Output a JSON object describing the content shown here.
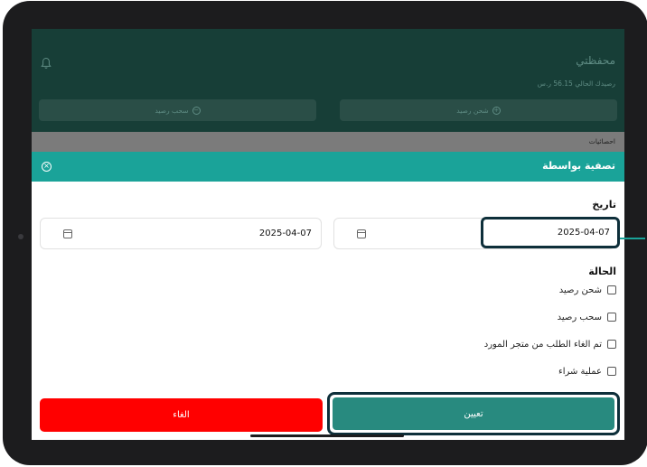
{
  "wallet": {
    "title": "محفظتي",
    "balance": "رصيدك الحالي 56.15 ر.س",
    "charge_label": "شحن رصيد",
    "withdraw_label": "سحب رصيد"
  },
  "stats_label": "احصائيات",
  "filter": {
    "title": "تصفية بواسطة",
    "date_label": "تاريخ",
    "date_from": "2025-04-07",
    "date_to": "2025-04-07",
    "status_label": "الحالة",
    "options": [
      "شحن رصيد",
      "سحب رصيد",
      "تم الغاء الطلب من متجر المورد",
      "عملية شراء"
    ],
    "apply_label": "تعيين",
    "cancel_label": "الغاء"
  },
  "colors": {
    "accent": "#1aa399",
    "apply": "#288a7f",
    "cancel": "#ff0000",
    "highlight": "#0e2f3a"
  },
  "icons": [
    "bell-icon",
    "close-icon",
    "calendar-icon",
    "plus-circle-icon",
    "minus-circle-icon"
  ]
}
